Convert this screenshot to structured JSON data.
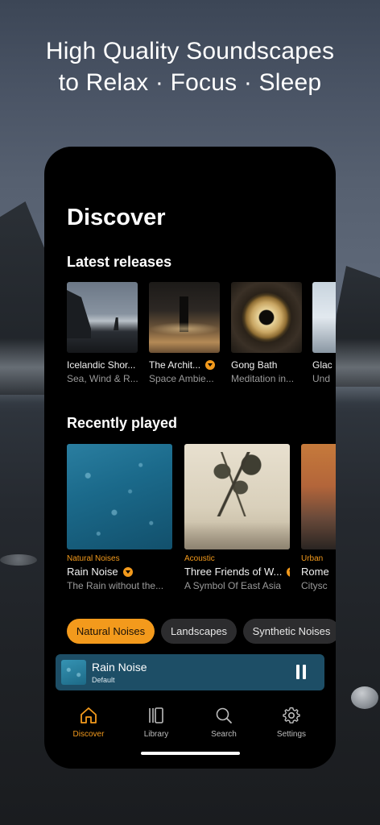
{
  "headline": {
    "line1": "High Quality Soundscapes",
    "line2": "to Relax · Focus · Sleep"
  },
  "page_title": "Discover",
  "latest_releases": {
    "title": "Latest releases",
    "items": [
      {
        "title": "Icelandic Shor...",
        "subtitle": "Sea, Wind & R...",
        "downloadable": false,
        "art": "icelandic-shore-art"
      },
      {
        "title": "The Archit...",
        "subtitle": "Space Ambie...",
        "downloadable": true,
        "art": "monolith-art"
      },
      {
        "title": "Gong Bath",
        "subtitle": "Meditation in...",
        "downloadable": false,
        "art": "gong-art"
      },
      {
        "title": "Glac",
        "subtitle": "Und",
        "downloadable": false,
        "art": "glacier-art"
      }
    ]
  },
  "recently_played": {
    "title": "Recently played",
    "items": [
      {
        "category": "Natural Noises",
        "title": "Rain Noise",
        "subtitle": "The Rain without the...",
        "downloadable": true,
        "art": "rain-art"
      },
      {
        "category": "Acoustic",
        "title": "Three Friends of W...",
        "subtitle": "A Symbol Of East Asia",
        "downloadable": true,
        "art": "bamboo-art"
      },
      {
        "category": "Urban",
        "title": "Rome",
        "subtitle": "Citysc",
        "downloadable": false,
        "art": "rome-art"
      }
    ]
  },
  "chips": [
    {
      "label": "Natural Noises",
      "active": true
    },
    {
      "label": "Landscapes",
      "active": false
    },
    {
      "label": "Synthetic Noises",
      "active": false
    }
  ],
  "mini_player": {
    "title": "Rain Noise",
    "subtitle": "Default",
    "state": "playing"
  },
  "tabs": [
    {
      "label": "Discover",
      "icon": "home-icon",
      "active": true
    },
    {
      "label": "Library",
      "icon": "library-icon",
      "active": false
    },
    {
      "label": "Search",
      "icon": "search-icon",
      "active": false
    },
    {
      "label": "Settings",
      "icon": "gear-icon",
      "active": false
    }
  ],
  "colors": {
    "accent": "#f39a1c",
    "player_bg": "#1d4e66",
    "chip_bg": "#2c2c2e"
  }
}
